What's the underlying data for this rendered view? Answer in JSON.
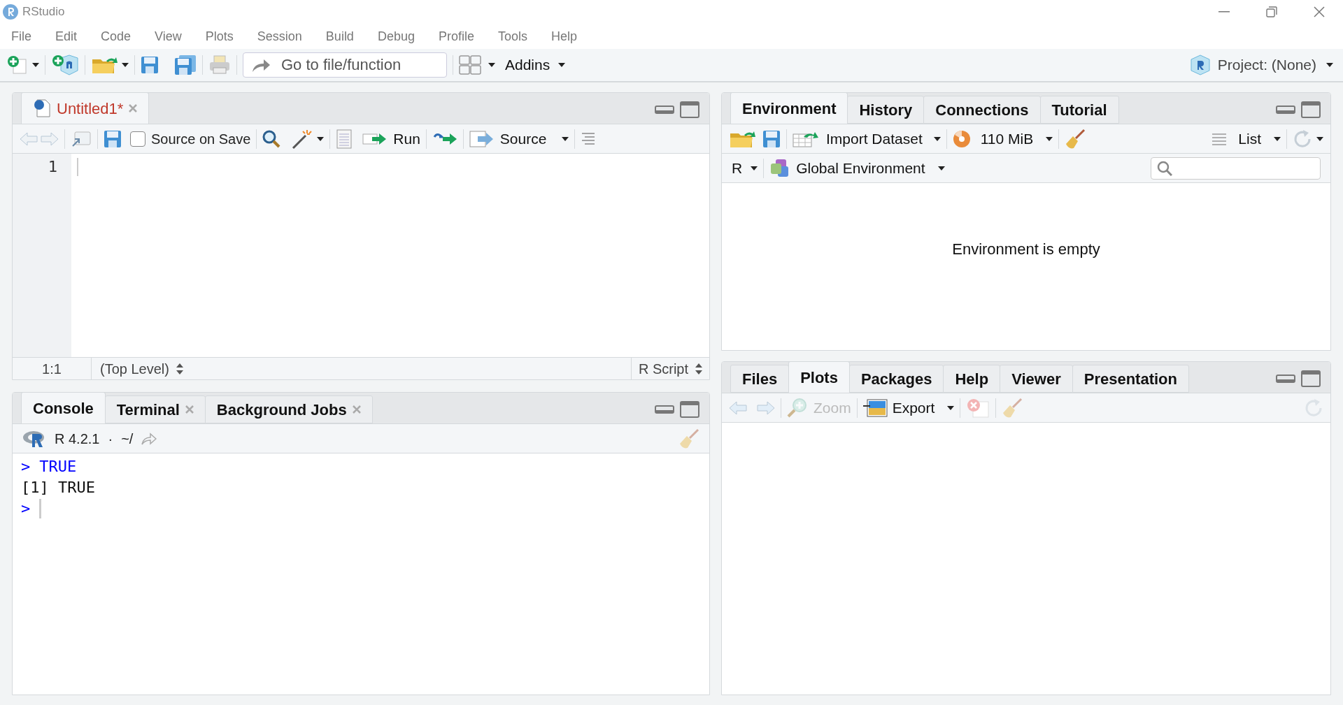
{
  "window": {
    "title": "RStudio"
  },
  "menu": [
    "File",
    "Edit",
    "Code",
    "View",
    "Plots",
    "Session",
    "Build",
    "Debug",
    "Profile",
    "Tools",
    "Help"
  ],
  "main_toolbar": {
    "goto_placeholder": "Go to file/function",
    "addins": "Addins",
    "project": "Project: (None)"
  },
  "source_pane": {
    "tabs": [
      {
        "label": "Untitled1*",
        "selected": true,
        "modified": true
      }
    ],
    "source_on_save": {
      "label": "Source on Save",
      "checked": false
    },
    "run": "Run",
    "source": "Source",
    "line_numbers": [
      "1"
    ],
    "status": {
      "position": "1:1",
      "scope": "(Top Level)",
      "file_type": "R Script"
    }
  },
  "console_pane": {
    "tabs": [
      {
        "label": "Console",
        "selected": true,
        "closable": false
      },
      {
        "label": "Terminal",
        "selected": false,
        "closable": true
      },
      {
        "label": "Background Jobs",
        "selected": false,
        "closable": true
      }
    ],
    "version": "R 4.2.1",
    "separator": "·",
    "path": "~/",
    "lines": [
      {
        "kind": "input",
        "prompt": ">",
        "text": "TRUE"
      },
      {
        "kind": "output",
        "text": "[1] TRUE"
      },
      {
        "kind": "prompt",
        "prompt": ">"
      }
    ]
  },
  "environment_pane": {
    "tabs": [
      {
        "label": "Environment",
        "selected": true
      },
      {
        "label": "History",
        "selected": false
      },
      {
        "label": "Connections",
        "selected": false
      },
      {
        "label": "Tutorial",
        "selected": false
      }
    ],
    "import": "Import Dataset",
    "memory": "110 MiB",
    "view": "List",
    "language": "R",
    "scope": "Global Environment",
    "message": "Environment is empty"
  },
  "files_pane": {
    "tabs": [
      {
        "label": "Files",
        "selected": false
      },
      {
        "label": "Plots",
        "selected": true
      },
      {
        "label": "Packages",
        "selected": false
      },
      {
        "label": "Help",
        "selected": false
      },
      {
        "label": "Viewer",
        "selected": false
      },
      {
        "label": "Presentation",
        "selected": false
      }
    ],
    "zoom": {
      "label": "Zoom",
      "disabled": true
    },
    "export": {
      "label": "Export",
      "disabled": false
    }
  }
}
